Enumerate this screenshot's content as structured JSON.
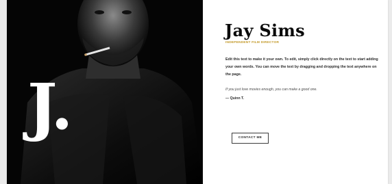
{
  "hero": {
    "monogram": "J."
  },
  "profile": {
    "name": "Jay Sims",
    "role": "INDEPENDENT FILM DIRECTOR",
    "bio": "Edit this text to make it your own. To edit, simply click directly on the text to start adding your own words. You can move the text by dragging and dropping the text anywhere on the page.",
    "quote": "If you just love movies enough, you can make a good one.",
    "quote_author": "— Quinn T.",
    "contact_label": "CONTACT ME"
  },
  "colors": {
    "accent": "#c39a2a",
    "photo_bg": "#050505",
    "text": "#2b2b2b"
  }
}
